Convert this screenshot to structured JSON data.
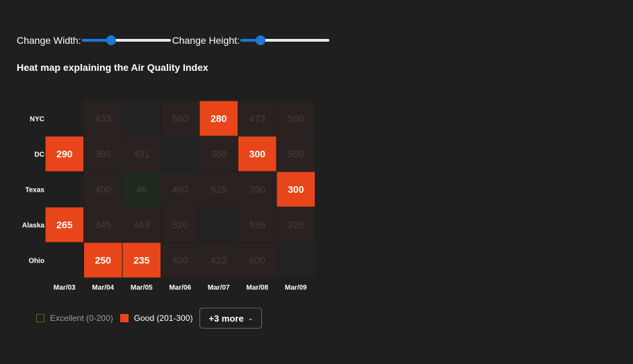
{
  "controls": {
    "width_label": "Change Width:",
    "height_label": "Change Height:",
    "width_slider_value": 0.33,
    "height_slider_value": 0.23
  },
  "colors": {
    "background": "#1f1f1f",
    "good": "#e8461a",
    "excellent_border": "#6b5b1e",
    "accent": "#1d78d8"
  },
  "legend": {
    "items": [
      {
        "label": "Excellent (0-200)",
        "color": "#6b5b1e",
        "active": false
      },
      {
        "label": "Good (201-300)",
        "color": "#e8461a",
        "active": true
      }
    ],
    "more_label": "+3 more",
    "more_icon": "chevron-down-icon"
  },
  "chart_data": {
    "type": "heatmap",
    "title": "Heat map explaining the Air Quality Index",
    "x_categories": [
      "Mar/03",
      "Mar/04",
      "Mar/05",
      "Mar/06",
      "Mar/07",
      "Mar/08",
      "Mar/09"
    ],
    "y_categories": [
      "NYC",
      "DC",
      "Texas",
      "Alaska",
      "Ohio"
    ],
    "values": [
      [
        null,
        433,
        null,
        580,
        280,
        473,
        590
      ],
      [
        290,
        385,
        491,
        null,
        360,
        300,
        560
      ],
      [
        null,
        400,
        46,
        480,
        525,
        390,
        300
      ],
      [
        265,
        345,
        463,
        520,
        null,
        536,
        325
      ],
      [
        null,
        250,
        235,
        400,
        423,
        600,
        null
      ]
    ],
    "highlighted_category": "Good (201-300)"
  }
}
